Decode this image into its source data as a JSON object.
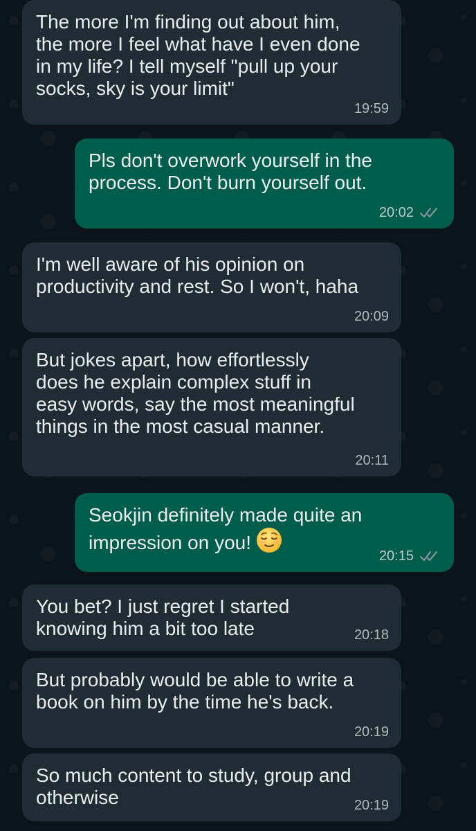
{
  "messages": [
    {
      "direction": "incoming",
      "text": "The more I'm finding out about him,\nthe more I feel what have I even done\nin my life? I tell myself \"pull up your\nsocks, sky is your limit\"",
      "time": "19:59"
    },
    {
      "direction": "outgoing",
      "text": "Pls don't overwork yourself in the\nprocess. Don't burn yourself out.",
      "time": "20:02",
      "status": "read"
    },
    {
      "direction": "incoming",
      "text": "I'm well aware of his opinion on\nproductivity and rest. So I won't, haha",
      "time": "20:09"
    },
    {
      "direction": "incoming",
      "text": "But jokes apart, how effortlessly\ndoes he explain complex stuff in\neasy words, say the most meaningful\nthings in the most casual manner.",
      "time": "20:11"
    },
    {
      "direction": "outgoing",
      "text": "Seokjin definitely made quite an\nimpression on you!",
      "time": "20:15",
      "status": "read",
      "emoji": "relieved-face-icon"
    },
    {
      "direction": "incoming",
      "text": "You bet? I just regret I started\nknowing him a bit too late",
      "time": "20:18"
    },
    {
      "direction": "incoming",
      "text": "But probably would be able to write a\nbook on him by the time he's back.",
      "time": "20:19"
    },
    {
      "direction": "incoming",
      "text": "So much content to study, group and\notherwise",
      "time": "20:19"
    }
  ],
  "colors": {
    "background": "#0b141a",
    "incoming_bubble": "#202c33",
    "outgoing_bubble": "#005c4b",
    "text": "#e9edef",
    "read_ticks": "#8696a0"
  }
}
